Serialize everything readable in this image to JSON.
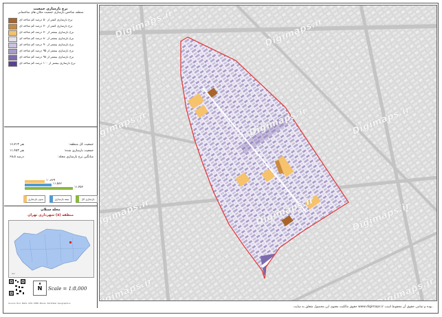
{
  "legend": {
    "title_line1": "نرخ بازسازی جمعیت",
    "title_line2": "منطقه شاخص بازسازی جمعیت مکان های ساختمانی",
    "items": [
      {
        "label": "نرخ بازسازی کمتر از ۵۰ درصد کم شاخه ای",
        "color": "#a8642a"
      },
      {
        "label": "نرخ بازسازی کمتر از ۷۰ درصد کم شاخه ای",
        "color": "#c98a3f"
      },
      {
        "label": "نرخ بازسازی بیشتر از ۷۰ درصد کم شاخه ای",
        "color": "#f6c26b"
      },
      {
        "label": "نرخ بازسازی بیشتر از ۸۰ درصد کم شاخه ای",
        "color": "#e4e0ee"
      },
      {
        "label": "نرخ بازسازی بیشتر از ۹۰ درصد کم شاخه ای",
        "color": "#c9c2e0"
      },
      {
        "label": "نرخ بازسازی بیشتر از ۹۵ درصد کم شاخه ای",
        "color": "#a89acb"
      },
      {
        "label": "نرخ بازسازی بیشتر از ۹۸ درصد کم شاخه ای",
        "color": "#7d6bb0"
      },
      {
        "label": "نرخ بازسازی بیشتر از ۱۰۰ درصد کم شاخه ای",
        "color": "#5a3f92"
      }
    ]
  },
  "stats": [
    {
      "label": "جمعیت کل منطقه:",
      "value": "۱۶،۷۱۳ نفر"
    },
    {
      "label": "جمعیت بازسازی شده:",
      "value": "۱۱،۴۵۳ نفر"
    },
    {
      "label": "میانگین نرخ بازسازی محله:",
      "value": "۶۸،۵ درصد"
    }
  ],
  "bars": [
    {
      "value": "۱۰،۸۶۹",
      "fill": 0.3,
      "color": "#f6c26b"
    },
    {
      "value": "۱۱،۵۸۷",
      "fill": 0.4,
      "color": "#4f9bd4"
    },
    {
      "value": "۱۱،۴۵۳",
      "fill": 0.72,
      "color": "#8ab83c"
    }
  ],
  "pills": [
    {
      "label": "بازسازی کل",
      "color": "#8ab83c"
    },
    {
      "label": "نیمه بازسازی",
      "color": "#4f9bd4"
    },
    {
      "label": "بدون بازسازی",
      "color": "#f6c26b"
    }
  ],
  "inset": {
    "title": "محله سبلان",
    "subtitle": "منطقه (۸) شهرداری تهران"
  },
  "scale": "Scale = 1:8,000",
  "north": "N",
  "credit": "Source: Esri, NGIS, CPO, MEB, Maxar, Earthstar Geographics",
  "watermark": "Digimaps.ir",
  "footer": "حقوق مالکیت معنوی این محصول متعلق به سایت www.digimaps.ir بوده و تمامی حقوق آن محفوظ است."
}
